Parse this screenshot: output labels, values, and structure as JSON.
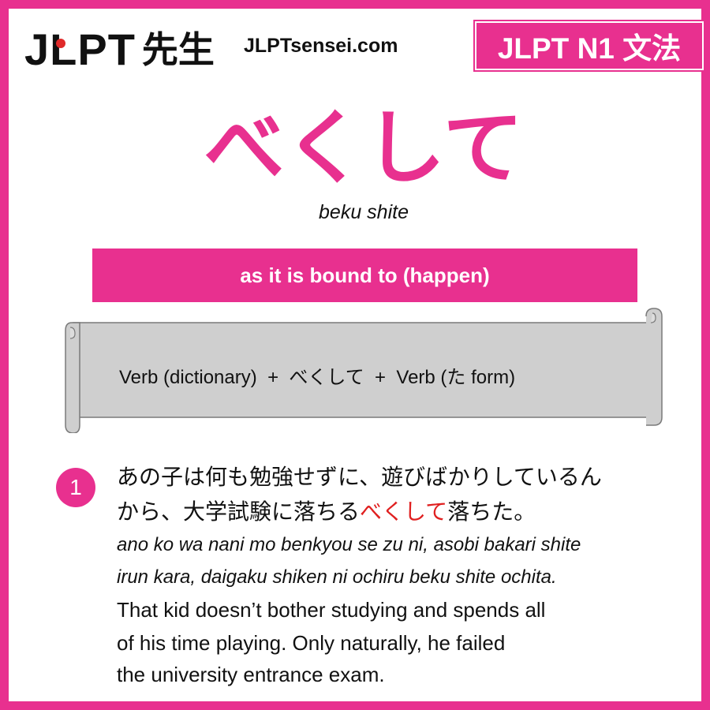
{
  "header": {
    "logo_latin": "JLPT",
    "logo_kanji": "先生",
    "site": "JLPTsensei.com",
    "level_badge": "JLPT N1 文法"
  },
  "grammar": {
    "headword": "べくして",
    "romaji": "beku shite",
    "meaning": "as it is bound to (happen)",
    "pattern": "Verb (dictionary)  +  べくして  +  Verb (た form)"
  },
  "example": {
    "number": "1",
    "japanese_line1": "あの子は何も勉強せずに、遊びばかりしているん",
    "japanese_line2_before": "から、大学試験に落ちる",
    "japanese_line2_highlight": "べくして",
    "japanese_line2_after": "落ちた。",
    "romaji_line1": "ano ko wa nani mo benkyou se zu ni, asobi bakari shite",
    "romaji_line2": "irun kara, daigaku shiken ni ochiru beku shite ochita.",
    "english_line1": "That kid doesn’t bother studying and spends all",
    "english_line2": "of his time playing. Only naturally, he failed",
    "english_line3": "the university entrance exam."
  },
  "colors": {
    "brand_pink": "#e8308f",
    "highlight_red": "#e02020",
    "scroll_gray": "#cfcfcf"
  }
}
